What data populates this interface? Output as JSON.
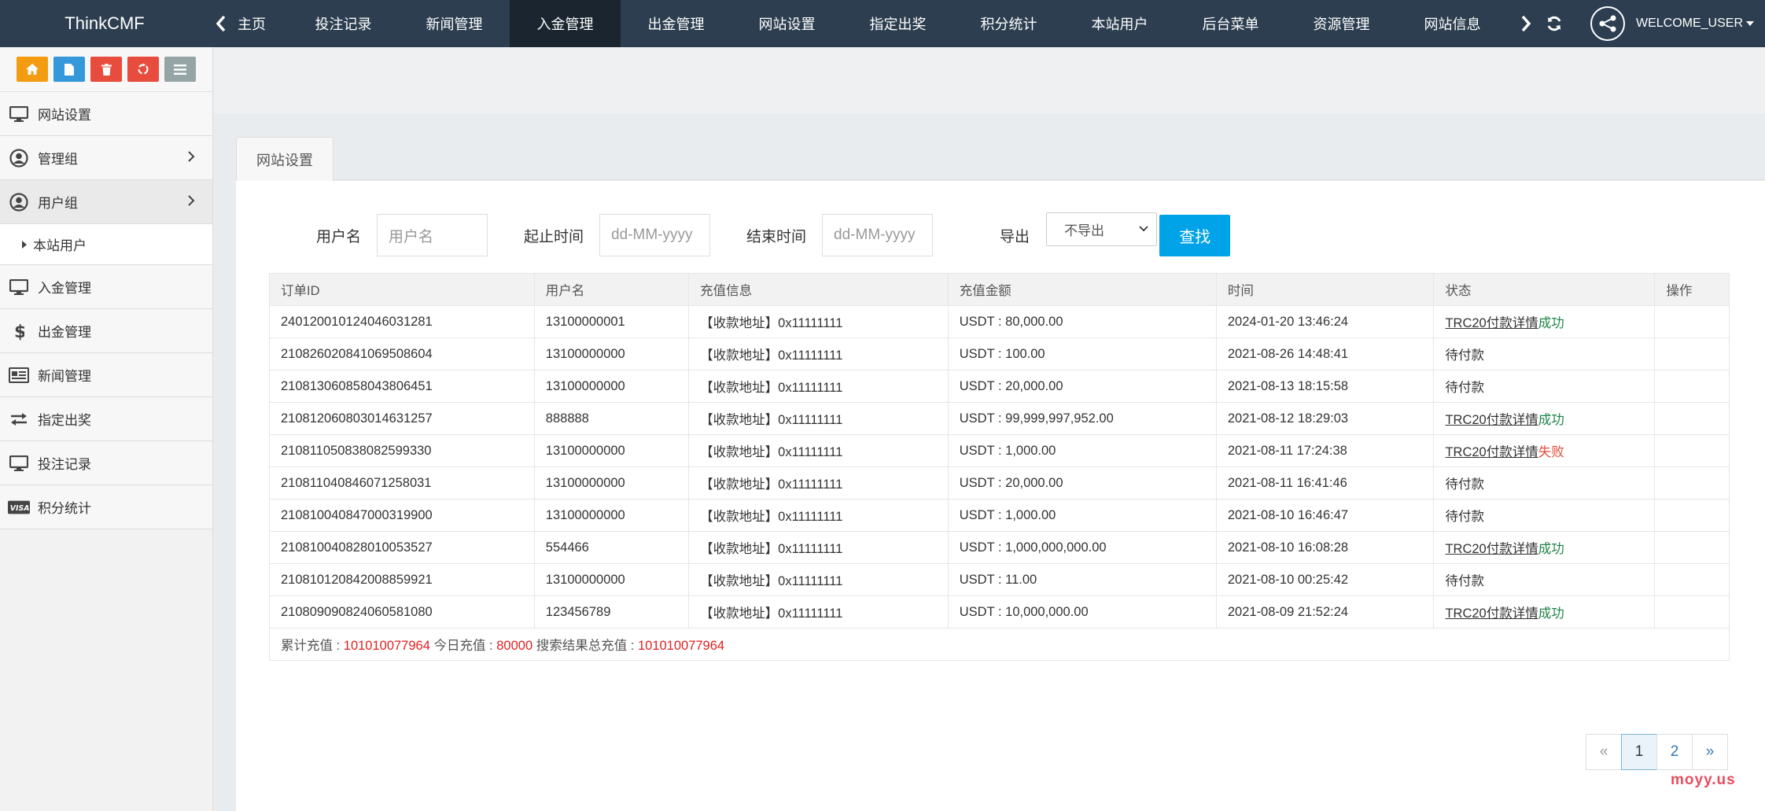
{
  "navbar": {
    "brand": "ThinkCMF",
    "home": "主页",
    "items": [
      "投注记录",
      "新闻管理",
      "入金管理",
      "出金管理",
      "网站设置",
      "指定出奖",
      "积分统计",
      "本站用户",
      "后台菜单",
      "资源管理",
      "网站信息"
    ],
    "active_index": 2,
    "user": "WELCOME_USER"
  },
  "sidebar": {
    "shortcut_colors": [
      "#f39c12",
      "#3498db",
      "#e74c3c",
      "#e74c3c",
      "#95a5a6"
    ],
    "items": [
      {
        "label": "网站设置",
        "icon": "monitor-icon"
      },
      {
        "label": "管理组",
        "icon": "user-circle-icon",
        "chevron": true
      },
      {
        "label": "用户组",
        "icon": "user-circle-icon",
        "chevron": true,
        "open": true
      },
      {
        "label": "本站用户",
        "sub": true
      },
      {
        "label": "入金管理",
        "icon": "monitor-icon"
      },
      {
        "label": "出金管理",
        "icon": "dollar-icon"
      },
      {
        "label": "新闻管理",
        "icon": "newspaper-icon"
      },
      {
        "label": "指定出奖",
        "icon": "exchange-icon"
      },
      {
        "label": "投注记录",
        "icon": "monitor-icon"
      },
      {
        "label": "积分统计",
        "icon": "visa-icon"
      }
    ]
  },
  "tab": {
    "label": "网站设置"
  },
  "filters": {
    "username_label": "用户名",
    "username_placeholder": "用户名",
    "start_label": "起止时间",
    "start_placeholder": "dd-MM-yyyy",
    "end_label": "结束时间",
    "end_placeholder": "dd-MM-yyyy",
    "export_label": "导出",
    "export_value": "不导出",
    "search_button": "查找"
  },
  "table": {
    "headers": [
      "订单ID",
      "用户名",
      "充值信息",
      "充值金额",
      "时间",
      "状态",
      "操作"
    ],
    "rows": [
      {
        "id": "240120010124046031281",
        "user": "13100000001",
        "info": "【收款地址】0x11111111",
        "amount": "USDT : 80,000.00",
        "time": "2024-01-20 13:46:24",
        "link": "TRC20付款详情",
        "status": "成功",
        "status_type": "ok"
      },
      {
        "id": "210826020841069508604",
        "user": "13100000000",
        "info": "【收款地址】0x11111111",
        "amount": "USDT : 100.00",
        "time": "2021-08-26 14:48:41",
        "link": "",
        "status": "待付款",
        "status_type": "pending"
      },
      {
        "id": "210813060858043806451",
        "user": "13100000000",
        "info": "【收款地址】0x11111111",
        "amount": "USDT : 20,000.00",
        "time": "2021-08-13 18:15:58",
        "link": "",
        "status": "待付款",
        "status_type": "pending"
      },
      {
        "id": "210812060803014631257",
        "user": "888888",
        "info": "【收款地址】0x11111111",
        "amount": "USDT : 99,999,997,952.00",
        "time": "2021-08-12 18:29:03",
        "link": "TRC20付款详情",
        "status": "成功",
        "status_type": "ok"
      },
      {
        "id": "210811050838082599330",
        "user": "13100000000",
        "info": "【收款地址】0x11111111",
        "amount": "USDT : 1,000.00",
        "time": "2021-08-11 17:24:38",
        "link": "TRC20付款详情",
        "status": "失败",
        "status_type": "fail"
      },
      {
        "id": "210811040846071258031",
        "user": "13100000000",
        "info": "【收款地址】0x11111111",
        "amount": "USDT : 20,000.00",
        "time": "2021-08-11 16:41:46",
        "link": "",
        "status": "待付款",
        "status_type": "pending"
      },
      {
        "id": "210810040847000319900",
        "user": "13100000000",
        "info": "【收款地址】0x11111111",
        "amount": "USDT : 1,000.00",
        "time": "2021-08-10 16:46:47",
        "link": "",
        "status": "待付款",
        "status_type": "pending"
      },
      {
        "id": "210810040828010053527",
        "user": "554466",
        "info": "【收款地址】0x11111111",
        "amount": "USDT : 1,000,000,000.00",
        "time": "2021-08-10 16:08:28",
        "link": "TRC20付款详情",
        "status": "成功",
        "status_type": "ok"
      },
      {
        "id": "210810120842008859921",
        "user": "13100000000",
        "info": "【收款地址】0x11111111",
        "amount": "USDT : 11.00",
        "time": "2021-08-10 00:25:42",
        "link": "",
        "status": "待付款",
        "status_type": "pending",
        "highlight": true
      },
      {
        "id": "210809090824060581080",
        "user": "123456789",
        "info": "【收款地址】0x11111111",
        "amount": "USDT : 10,000,000.00",
        "time": "2021-08-09 21:52:24",
        "link": "TRC20付款详情",
        "status": "成功",
        "status_type": "ok"
      }
    ],
    "summary": {
      "total_label": "累计充值 : ",
      "total_value": "101010077964",
      "today_label": " 今日充值 : ",
      "today_value": "80000",
      "search_label": " 搜索结果总充值 : ",
      "search_value": "101010077964"
    }
  },
  "pagination": {
    "prev": "«",
    "pages": [
      "1",
      "2"
    ],
    "current": "1",
    "next": "»"
  },
  "watermark": "moyy.us"
}
